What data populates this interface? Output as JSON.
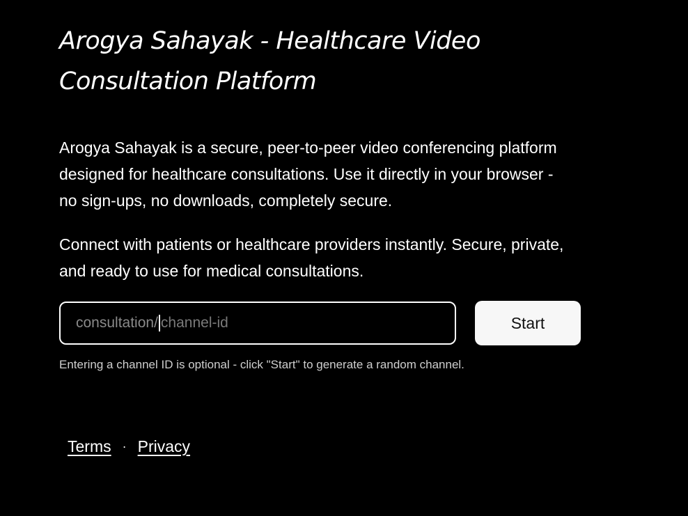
{
  "header": {
    "title": "Arogya Sahayak - Healthcare Video Consultation Platform"
  },
  "main": {
    "intro": "Arogya Sahayak is a secure, peer-to-peer video conferencing platform designed for healthcare consultations. Use it directly in your browser - no sign-ups, no downloads, completely secure.",
    "intro2": "Connect with patients or healthcare providers instantly. Secure, private, and ready to use for medical consultations."
  },
  "form": {
    "channel_prefix": "consultation/",
    "channel_placeholder": "channel-id",
    "start_label": "Start",
    "hint": "Entering a channel ID is optional - click \"Start\" to generate a random channel."
  },
  "footer": {
    "terms_label": "Terms",
    "separator": "·",
    "privacy_label": "Privacy"
  },
  "colors": {
    "background": "#000000",
    "text": "#ffffff",
    "button_bg": "#f7f7f7"
  }
}
